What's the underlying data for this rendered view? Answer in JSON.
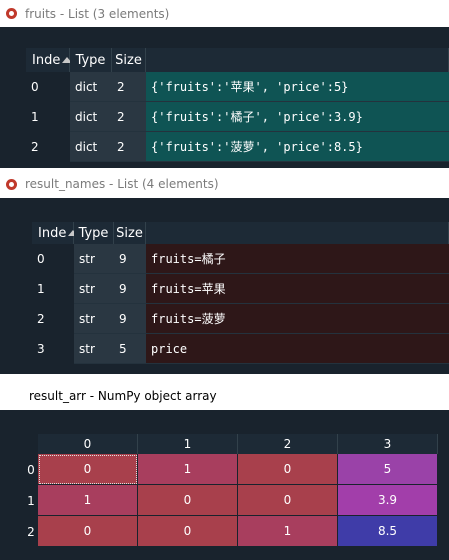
{
  "fruits_window": {
    "title": "fruits - List (3 elements)",
    "columns": [
      "Inde",
      "Type",
      "Size",
      ""
    ],
    "rows": [
      {
        "index": "0",
        "type": "dict",
        "size": "2",
        "value": "{'fruits':'苹果', 'price':5}"
      },
      {
        "index": "1",
        "type": "dict",
        "size": "2",
        "value": "{'fruits':'橘子', 'price':3.9}"
      },
      {
        "index": "2",
        "type": "dict",
        "size": "2",
        "value": "{'fruits':'菠萝', 'price':8.5}"
      }
    ],
    "row_color": "#0f5454"
  },
  "result_names_window": {
    "title": "result_names - List (4 elements)",
    "columns": [
      "Inde",
      "Type",
      "Size",
      ""
    ],
    "rows": [
      {
        "index": "0",
        "type": "str",
        "size": "9",
        "value": "fruits=橘子"
      },
      {
        "index": "1",
        "type": "str",
        "size": "9",
        "value": "fruits=苹果"
      },
      {
        "index": "2",
        "type": "str",
        "size": "9",
        "value": "fruits=菠萝"
      },
      {
        "index": "3",
        "type": "str",
        "size": "5",
        "value": "price"
      }
    ],
    "row_color": "#2e1718"
  },
  "result_arr_window": {
    "title": "result_arr - NumPy object array",
    "col_headers": [
      "0",
      "1",
      "2",
      "3"
    ],
    "row_headers": [
      "0",
      "1",
      "2"
    ],
    "cells": [
      [
        {
          "v": "0",
          "c": "#a8404c"
        },
        {
          "v": "1",
          "c": "#a83e5e"
        },
        {
          "v": "0",
          "c": "#a8404c"
        },
        {
          "v": "5",
          "c": "#9a42a8"
        }
      ],
      [
        {
          "v": "1",
          "c": "#a83e5e"
        },
        {
          "v": "0",
          "c": "#a8404c"
        },
        {
          "v": "0",
          "c": "#a8404c"
        },
        {
          "v": "3.9",
          "c": "#a23eaa"
        }
      ],
      [
        {
          "v": "0",
          "c": "#a8404c"
        },
        {
          "v": "0",
          "c": "#a8404c"
        },
        {
          "v": "1",
          "c": "#a83e5e"
        },
        {
          "v": "8.5",
          "c": "#3f3ca8"
        }
      ]
    ]
  }
}
